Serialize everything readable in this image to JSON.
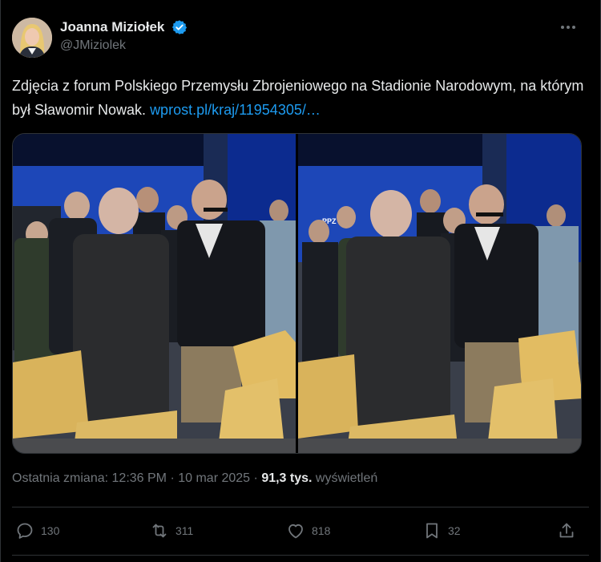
{
  "author": {
    "display_name": "Joanna Miziołek",
    "handle": "@JMiziolek",
    "verified": true
  },
  "tweet": {
    "text": "Zdjęcia z forum Polskiego Przemysłu Zbrojeniowego na Stadionie Narodowym, na którym był Sławomir Nowak.",
    "link": "wprost.pl/kraj/11954305/…"
  },
  "media": {
    "stage_sign": "PPZ"
  },
  "meta": {
    "edited_label": "Ostatnia zmiana:",
    "time": "12:36 PM",
    "date": "10 mar 2025",
    "separator": "·",
    "views_count": "91,3 tys.",
    "views_label": "wyświetleń"
  },
  "actions": {
    "replies": "130",
    "reposts": "311",
    "likes": "818",
    "bookmarks": "32"
  },
  "colors": {
    "background": "#000000",
    "text": "#e7e9ea",
    "muted": "#71767b",
    "link": "#1d9bf0",
    "border": "#2f3336",
    "verified": "#1d9bf0"
  }
}
